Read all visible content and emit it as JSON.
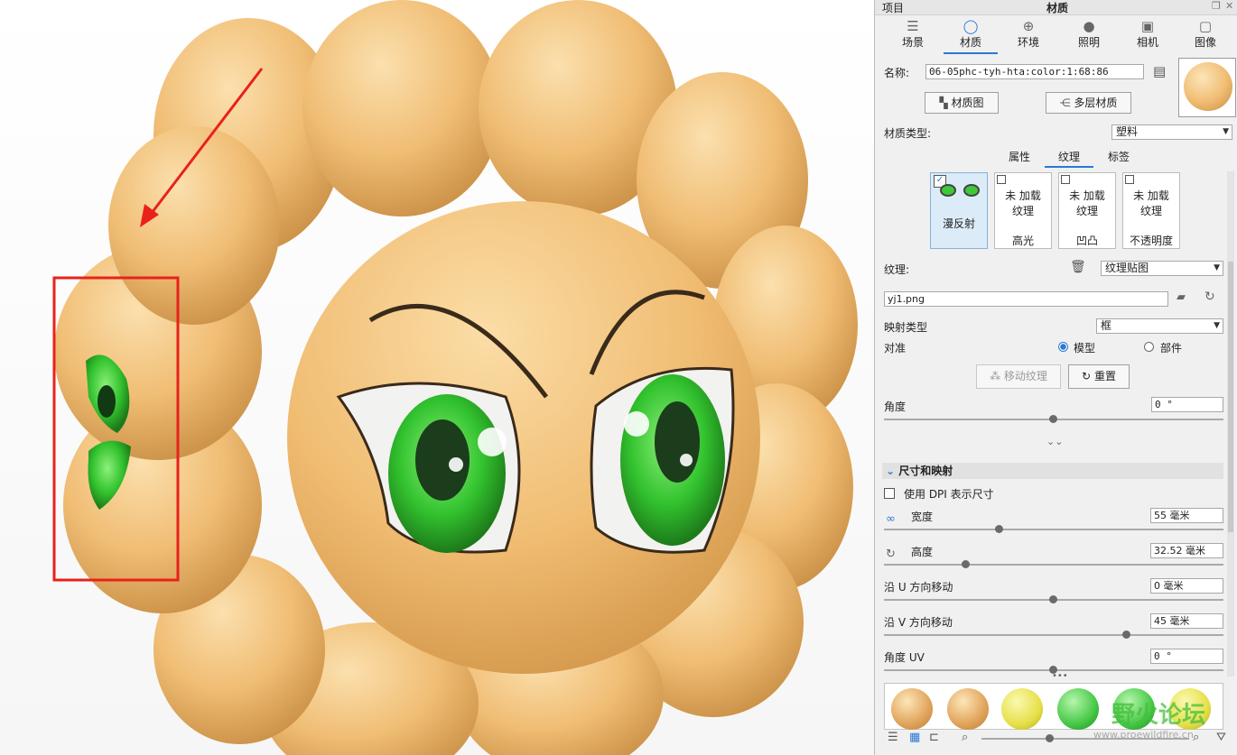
{
  "panel": {
    "header": {
      "left_title": "项目",
      "title": "材质"
    },
    "tabs": [
      {
        "label": "场景",
        "icon": "list-icon"
      },
      {
        "label": "材质",
        "icon": "material-ball-icon",
        "active": true
      },
      {
        "label": "环境",
        "icon": "globe-icon"
      },
      {
        "label": "照明",
        "icon": "bulb-icon"
      },
      {
        "label": "相机",
        "icon": "camera-icon"
      },
      {
        "label": "图像",
        "icon": "frame-icon"
      }
    ],
    "name_label": "名称:",
    "name_value": "06-05phc-tyh-hta:color:1:68:86",
    "material_graph_button": "材质图",
    "multilayer_button": "多层材质",
    "material_type_label": "材质类型:",
    "material_type_value": "塑料",
    "subtabs": [
      "属性",
      "纹理",
      "标签"
    ],
    "active_subtab": "纹理",
    "texture_cards": [
      {
        "title": "漫反射",
        "loaded": true
      },
      {
        "top": "未 加载\n纹理",
        "title": "高光",
        "loaded": false
      },
      {
        "top": "未 加载\n纹理",
        "title": "凹凸",
        "loaded": false
      },
      {
        "top": "未 加载\n纹理",
        "title": "不透明度",
        "loaded": false
      }
    ],
    "texture_label": "纹理:",
    "texture_type": "纹理贴图",
    "file_name": "yj1.png",
    "mapping_label": "映射类型",
    "mapping_value": "框",
    "align_label": "对准",
    "align_model": "模型",
    "align_part": "部件",
    "move_texture_button": "移动纹理",
    "reset_button": "重置",
    "angle_label": "角度",
    "angle_value": "0 °",
    "section_title": "尺寸和映射",
    "dpi_label": "使用 DPI 表示尺寸",
    "width_label": "宽度",
    "width_value": "55 毫米",
    "height_label": "高度",
    "height_value": "32.52 毫米",
    "u_label": "沿 U 方向移动",
    "u_value": "0 毫米",
    "v_label": "沿 V 方向移动",
    "v_value": "45 毫米",
    "angle_uv_label": "角度 UV",
    "angle_uv_value": "0 °",
    "swatch_colors": [
      "#e0a35a",
      "#e0a35a",
      "#e6e04a",
      "#46c846",
      "#46c846",
      "#e6e04a"
    ],
    "watermark": "野火论坛",
    "watermark_url": "www.proewildfire.cn"
  },
  "viewport": {
    "face_color": "#f2c27a",
    "eye_color": "#3ec83a",
    "annotation_color": "#e8221b"
  }
}
